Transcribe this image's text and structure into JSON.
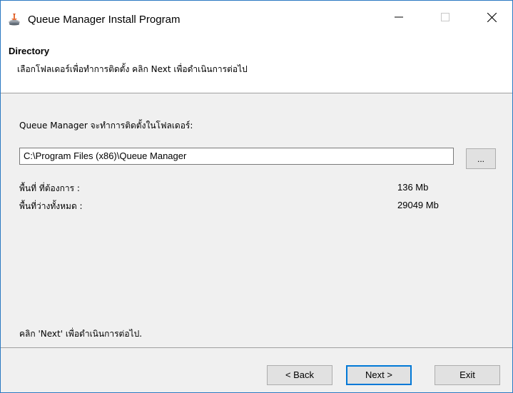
{
  "window": {
    "title": "Queue Manager Install Program",
    "accent_border": "#2b79c2",
    "controls": {
      "minimize": "minimize-icon",
      "maximize": "maximize-icon",
      "close": "close-icon"
    }
  },
  "header": {
    "title": "Directory",
    "subtitle": "เลือกโฟลเดอร์เพื่อทำการติดตั้ง คลิก Next เพื่อดำเนินการต่อไป"
  },
  "main": {
    "install_label": "Queue Manager จะทำการติดตั้งในโฟลเดอร์:",
    "path_value": "C:\\Program Files (x86)\\Queue Manager",
    "browse_label": "...",
    "space_required_label": "พื้นที่ ที่ต้องการ :",
    "space_required_value": "136 Mb",
    "space_free_label": "พื้นที่ว่างทั้งหมด :",
    "space_free_value": "29049 Mb",
    "hint": "คลิก 'Next' เพื่อดำเนินการต่อไป."
  },
  "footer": {
    "back_label": "< Back",
    "next_label": "Next >",
    "exit_label": "Exit",
    "default_button_color": "#0078d7"
  }
}
